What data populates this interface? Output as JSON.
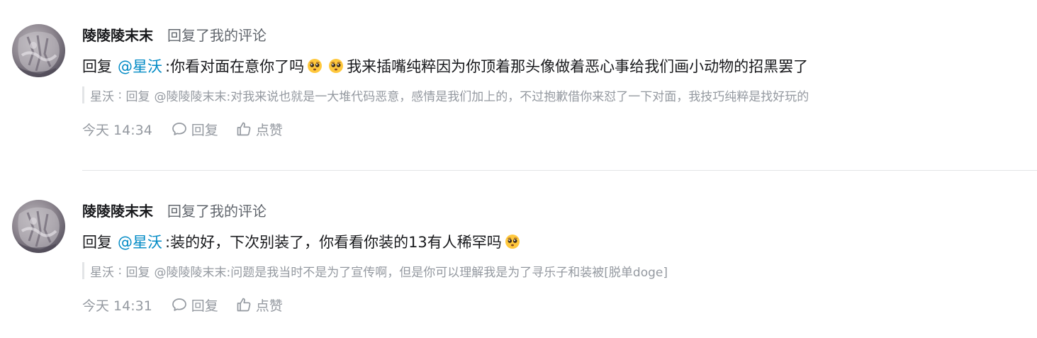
{
  "comments": [
    {
      "user_name": "陵陵陵末末",
      "action_text": "回复了我的评论",
      "reply_prefix": "回复",
      "mention": "@星沃",
      "body_before_emoji": ":你看对面在意你了吗",
      "emoji_icons": [
        "pleading-face-emoji",
        "pleading-face-emoji"
      ],
      "body_after_emoji": "我来插嘴纯粹因为你顶着那头像做着恶心事给我们画小动物的招黑罢了",
      "quote": {
        "author": "星沃",
        "separator": " : ",
        "reply_word": "回复",
        "mention": "@陵陵陵末末",
        "text": ":对我来说也就是一大堆代码恶意，感情是我们加上的，不过抱歉借你来怼了一下对面，我技巧纯粹是找好玩的"
      },
      "time": "今天 14:34",
      "reply_label": "回复",
      "like_label": "点赞"
    },
    {
      "user_name": "陵陵陵末末",
      "action_text": "回复了我的评论",
      "reply_prefix": "回复",
      "mention": "@星沃",
      "body_before_emoji": ":装的好，下次别装了，你看看你装的13有人稀罕吗",
      "emoji_icons": [
        "pleading-face-emoji"
      ],
      "body_after_emoji": "",
      "quote": {
        "author": "星沃",
        "separator": " : ",
        "reply_word": "回复",
        "mention": "@陵陵陵末末",
        "text": ":问题是我当时不是为了宣传啊，但是你可以理解我是为了寻乐子和装被[脱单doge]"
      },
      "time": "今天 14:31",
      "reply_label": "回复",
      "like_label": "点赞"
    }
  ],
  "colors": {
    "mention": "#008ac5",
    "muted": "#9499a0",
    "action": "#61666d",
    "text": "#18191c",
    "divider": "#e3e5e7"
  },
  "icons": {
    "reply": "speech-bubble-icon",
    "like": "thumbs-up-icon"
  }
}
